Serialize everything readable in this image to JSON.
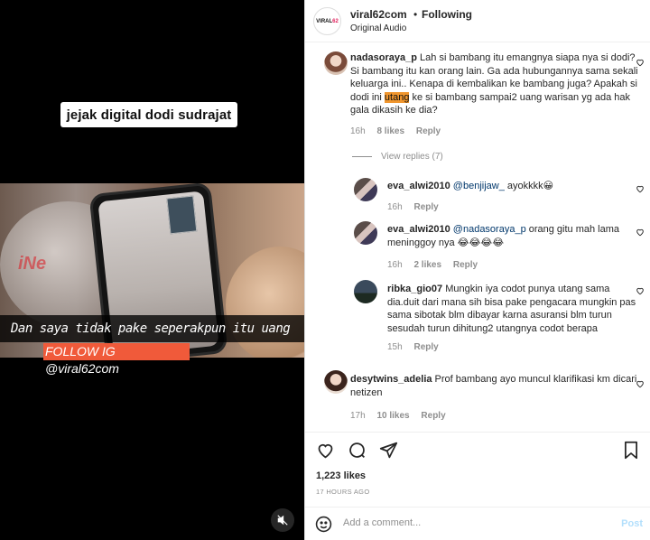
{
  "video": {
    "caption": "jejak digital dodi sudrajat",
    "brand_text": "iNe",
    "subtitle": "Dan saya tidak pake seperakpun itu uang",
    "follow_text": "FOLLOW IG @viral62com"
  },
  "header": {
    "avatar_text_a": "VIRAL",
    "avatar_text_b": "62",
    "username": "viral62com",
    "dot": "•",
    "follow_label": "Following",
    "audio": "Original Audio"
  },
  "comments": [
    {
      "user": "nadasoraya_p",
      "text_before": "Lah si bambang itu emangnya siapa nya si dodi? Si bambang itu kan orang lain. Ga ada hubungannya sama sekali keluarga ini.. Kenapa di kembalikan ke bambang juga? Apakah si dodi ini ",
      "highlight": "utang",
      "text_after": " ke si bambang sampai2 uang warisan yg ada hak gala dikasih ke dia?",
      "time": "16h",
      "likes": "8 likes",
      "reply": "Reply"
    },
    {
      "user": "eva_alwi2010",
      "mention": "@benjijaw_",
      "text": " ayokkkk😀",
      "time": "16h",
      "reply": "Reply"
    },
    {
      "user": "eva_alwi2010",
      "mention": "@nadasoraya_p",
      "text": " orang gitu mah lama meninggoy nya 😂😂😂😂",
      "time": "16h",
      "likes": "2 likes",
      "reply": "Reply"
    },
    {
      "user": "ribka_gio07",
      "text": " Mungkin iya codot punya utang sama dia.duit dari mana sih bisa pake pengacara mungkin pas sama sibotak blm dibayar karna asuransi blm turun sesudah turun dihitung2 utangnya codot berapa",
      "time": "15h",
      "reply": "Reply"
    },
    {
      "user": "desytwins_adelia",
      "text": " Prof bambang ayo muncul klarifikasi km dicari netizen",
      "time": "17h",
      "likes": "10 likes",
      "reply": "Reply"
    }
  ],
  "view_replies": "View replies (7)",
  "actions": {
    "likes": "1,223 likes",
    "ago": "17 HOURS AGO"
  },
  "add_comment": {
    "placeholder": "Add a comment...",
    "post_label": "Post"
  },
  "colors": {
    "accent": "#0095f6",
    "post_disabled": "#b2dffc",
    "highlight": "#f0962e",
    "follow_banner": "#f05a3a",
    "mention": "#00376b"
  }
}
